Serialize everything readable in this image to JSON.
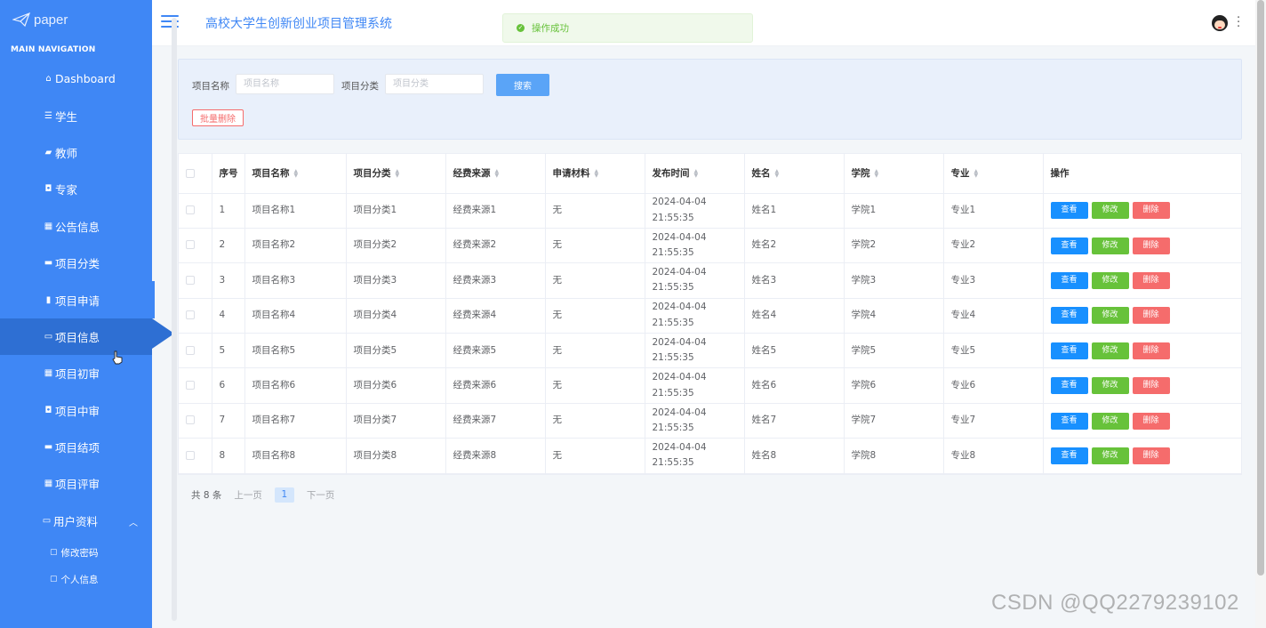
{
  "brand": {
    "name": "paper",
    "icon": "paper-plane-icon"
  },
  "sidebar": {
    "heading": "MAIN NAVIGATION",
    "items": [
      {
        "label": "Dashboard",
        "icon": "home-icon",
        "glyph": "⌂"
      },
      {
        "label": "学生",
        "icon": "sliders-icon",
        "glyph": "☰"
      },
      {
        "label": "教师",
        "icon": "thumbs-up-icon",
        "glyph": "▰"
      },
      {
        "label": "专家",
        "icon": "briefcase-icon",
        "glyph": "◘"
      },
      {
        "label": "公告信息",
        "icon": "grid-icon",
        "glyph": "▦"
      },
      {
        "label": "项目分类",
        "icon": "comment-icon",
        "glyph": "▬"
      },
      {
        "label": "项目申请",
        "icon": "bar-chart-icon",
        "glyph": "▮"
      },
      {
        "label": "项目信息",
        "icon": "folder-icon",
        "glyph": "▭"
      },
      {
        "label": "项目初审",
        "icon": "grid-icon",
        "glyph": "▦"
      },
      {
        "label": "项目中审",
        "icon": "briefcase-icon",
        "glyph": "◘"
      },
      {
        "label": "项目结项",
        "icon": "monitor-icon",
        "glyph": "▬"
      },
      {
        "label": "项目评审",
        "icon": "grid-icon",
        "glyph": "▦"
      }
    ],
    "group": {
      "label": "用户资料",
      "icon": "card-icon",
      "glyph": "▭",
      "caret": "︿"
    },
    "sub_items": [
      {
        "label": "修改密码",
        "icon": "folder-icon",
        "glyph": "▢"
      },
      {
        "label": "个人信息",
        "icon": "folder-icon",
        "glyph": "▢"
      }
    ],
    "active_index": 7
  },
  "header": {
    "title": "高校大学生创新创业项目管理系统",
    "toast": "操作成功"
  },
  "search": {
    "name_label": "项目名称",
    "name_placeholder": "项目名称",
    "category_label": "项目分类",
    "category_placeholder": "项目分类",
    "search_button": "搜索",
    "batch_delete_button": "批量删除"
  },
  "table": {
    "columns": [
      "序号",
      "项目名称",
      "项目分类",
      "经费来源",
      "申请材料",
      "发布时间",
      "姓名",
      "学院",
      "专业",
      "操作"
    ],
    "rows": [
      {
        "no": "1",
        "name": "项目名称1",
        "category": "项目分类1",
        "funding": "经费来源1",
        "material": "无",
        "time": "2024-04-04 21:55:35",
        "person": "姓名1",
        "college": "学院1",
        "major": "专业1"
      },
      {
        "no": "2",
        "name": "项目名称2",
        "category": "项目分类2",
        "funding": "经费来源2",
        "material": "无",
        "time": "2024-04-04 21:55:35",
        "person": "姓名2",
        "college": "学院2",
        "major": "专业2"
      },
      {
        "no": "3",
        "name": "项目名称3",
        "category": "项目分类3",
        "funding": "经费来源3",
        "material": "无",
        "time": "2024-04-04 21:55:35",
        "person": "姓名3",
        "college": "学院3",
        "major": "专业3"
      },
      {
        "no": "4",
        "name": "项目名称4",
        "category": "项目分类4",
        "funding": "经费来源4",
        "material": "无",
        "time": "2024-04-04 21:55:35",
        "person": "姓名4",
        "college": "学院4",
        "major": "专业4"
      },
      {
        "no": "5",
        "name": "项目名称5",
        "category": "项目分类5",
        "funding": "经费来源5",
        "material": "无",
        "time": "2024-04-04 21:55:35",
        "person": "姓名5",
        "college": "学院5",
        "major": "专业5"
      },
      {
        "no": "6",
        "name": "项目名称6",
        "category": "项目分类6",
        "funding": "经费来源6",
        "material": "无",
        "time": "2024-04-04 21:55:35",
        "person": "姓名6",
        "college": "学院6",
        "major": "专业6"
      },
      {
        "no": "7",
        "name": "项目名称7",
        "category": "项目分类7",
        "funding": "经费来源7",
        "material": "无",
        "time": "2024-04-04 21:55:35",
        "person": "姓名7",
        "college": "学院7",
        "major": "专业7"
      },
      {
        "no": "8",
        "name": "项目名称8",
        "category": "项目分类8",
        "funding": "经费来源8",
        "material": "无",
        "time": "2024-04-04 21:55:35",
        "person": "姓名8",
        "college": "学院8",
        "major": "专业8"
      }
    ],
    "actions": {
      "view": "查看",
      "edit": "修改",
      "delete": "删除"
    }
  },
  "pagination": {
    "total": "共 8 条",
    "prev": "上一页",
    "current": "1",
    "next": "下一页"
  },
  "watermark": "CSDN @QQ2279239102",
  "colors": {
    "sidebar": "#3f87f5",
    "active": "#2e6fd3",
    "view": "#1890ff",
    "edit": "#67c23a",
    "delete": "#f56c6c"
  }
}
